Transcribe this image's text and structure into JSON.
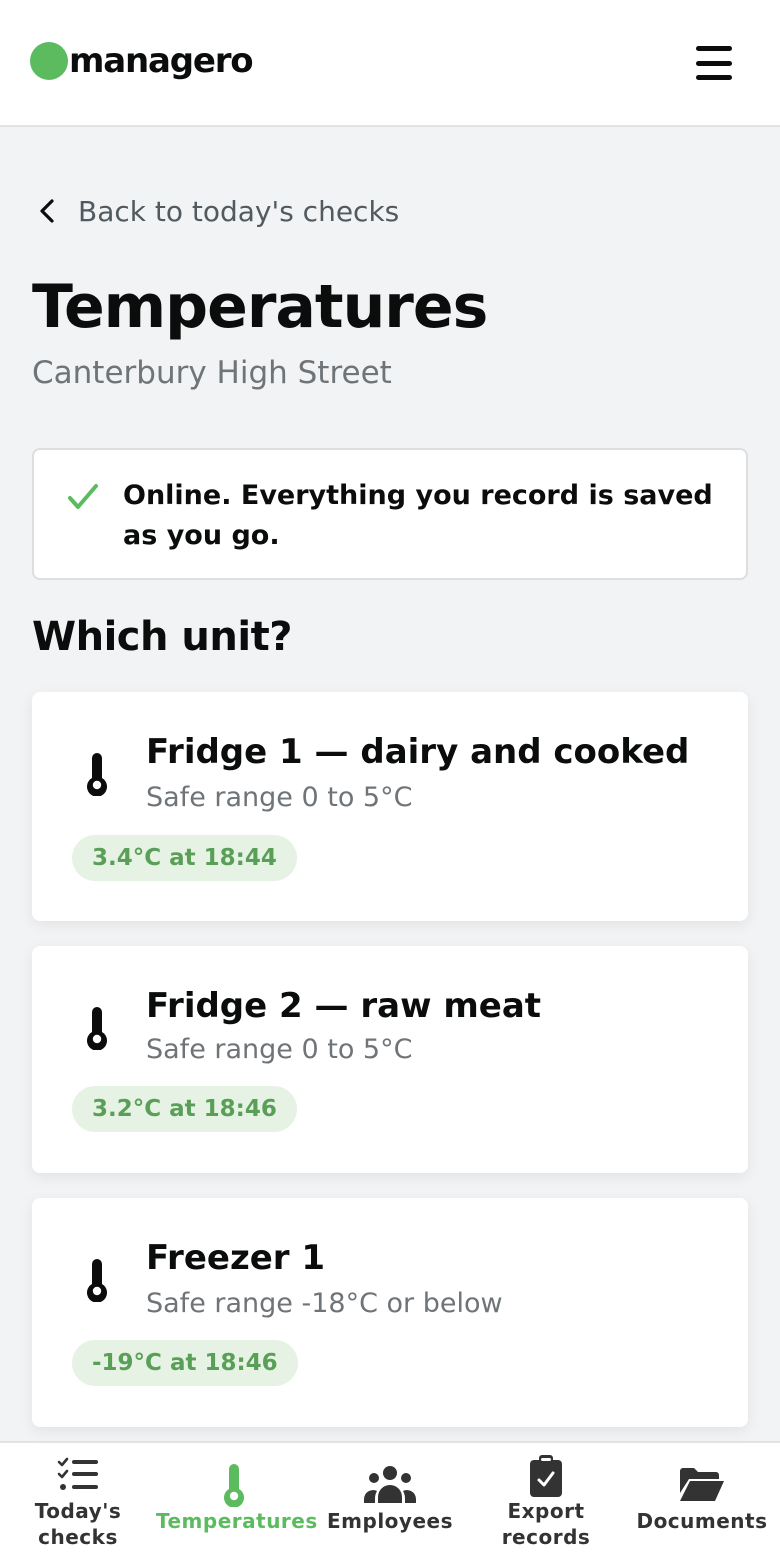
{
  "header": {
    "logo_text": "managero",
    "menu_icon": "hamburger-menu-icon"
  },
  "back_link": {
    "label": "Back to today's checks",
    "icon": "chevron-left-icon"
  },
  "page": {
    "title": "Temperatures",
    "subtitle": "Canterbury High Street"
  },
  "status": {
    "icon": "check-icon",
    "text": "Online. Everything you record is saved as you go."
  },
  "section_title": "Which unit?",
  "units": [
    {
      "name": "Fridge 1 — dairy and cooked",
      "range": "Safe range 0 to 5°C",
      "reading": "3.4°C at 18:44",
      "icon": "thermometer-icon"
    },
    {
      "name": "Fridge 2 — raw meat",
      "range": "Safe range 0 to 5°C",
      "reading": "3.2°C at 18:46",
      "icon": "thermometer-icon"
    },
    {
      "name": "Freezer 1",
      "range": "Safe range -18°C or below",
      "reading": "-19°C at 18:46",
      "icon": "thermometer-icon"
    }
  ],
  "bottom_nav": [
    {
      "label_line1": "Today's",
      "label_line2": "checks",
      "icon": "checklist-icon",
      "active": false
    },
    {
      "label": "Temperatures",
      "icon": "thermometer-icon",
      "active": true
    },
    {
      "label": "Employees",
      "icon": "users-icon",
      "active": false
    },
    {
      "label_line1": "Export",
      "label_line2": "records",
      "icon": "clipboard-check-icon",
      "active": false
    },
    {
      "label": "Documents",
      "icon": "folder-open-icon",
      "active": false
    }
  ],
  "colors": {
    "brand_green": "#5cbb5f",
    "badge_bg": "#e6f3e4",
    "badge_text": "#5a9f58",
    "page_bg": "#f2f3f5"
  }
}
